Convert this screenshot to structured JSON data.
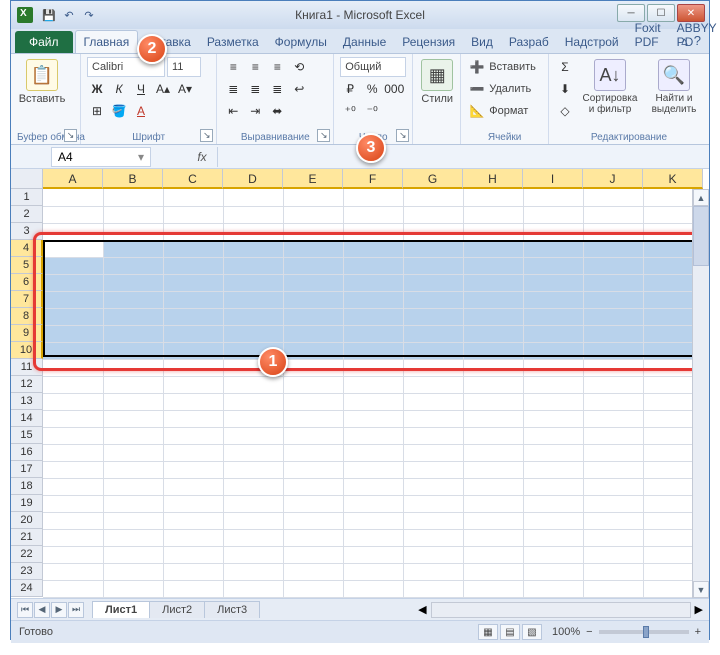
{
  "title": "Книга1 - Microsoft Excel",
  "qat": {
    "save": "💾",
    "undo": "↶",
    "redo": "↷"
  },
  "winbtns": {
    "min": "─",
    "max": "☐",
    "close": "✕"
  },
  "tabs": {
    "file": "Файл",
    "items": [
      "Главная",
      "Вставка",
      "Разметка",
      "Формулы",
      "Данные",
      "Рецензия",
      "Вид",
      "Разраб",
      "Надстрой",
      "Foxit PDF",
      "ABBYY PD"
    ],
    "active_index": 0
  },
  "help": {
    "up": "▵",
    "help": "?"
  },
  "ribbon": {
    "clipboard": {
      "paste": "Вставить",
      "label": "Буфер обмена",
      "icon": "📋"
    },
    "font": {
      "name": "Calibri",
      "size": "11",
      "label": "Шрифт",
      "bold": "Ж",
      "italic": "К",
      "underline": "Ч",
      "border": "⊞",
      "fill": "🪣",
      "color": "A"
    },
    "align": {
      "label": "Выравнивание",
      "tl": "≡",
      "tc": "≡",
      "tr": "≡",
      "wrap": "↩",
      "ml": "≣",
      "mc": "≣",
      "mr": "≣",
      "merge": "⬌",
      "il": "⇤",
      "ir": "⇥",
      "orient": "⟲"
    },
    "number": {
      "label": "Число",
      "format": "Общий",
      "cur": "%",
      "pct": "%",
      "comma": "000",
      "inc": "⁺⁰",
      "dec": "⁻⁰"
    },
    "styles": {
      "label": "Стили",
      "btn": "Стили",
      "icon": "▦"
    },
    "cells": {
      "label": "Ячейки",
      "insert": "Вставить",
      "delete": "Удалить",
      "format": "Формат",
      "ins_icon": "➕",
      "del_icon": "➖",
      "fmt_icon": "📐"
    },
    "editing": {
      "label": "Редактирование",
      "sum": "Σ",
      "fill": "⬇",
      "clear": "◇",
      "sort": "Сортировка и фильтр",
      "find": "Найти и выделить",
      "sort_icon": "A↓",
      "find_icon": "🔍"
    }
  },
  "fx": {
    "cell": "A4",
    "fx": "fx"
  },
  "columns": [
    "A",
    "B",
    "C",
    "D",
    "E",
    "F",
    "G",
    "H",
    "I",
    "J",
    "K"
  ],
  "rows_total": 24,
  "selection": {
    "row_start": 4,
    "row_end": 10,
    "active": "A4"
  },
  "sheets": {
    "nav": [
      "⏮",
      "◀",
      "▶",
      "⏭"
    ],
    "items": [
      "Лист1",
      "Лист2",
      "Лист3"
    ],
    "active": 0,
    "add": "+"
  },
  "status": {
    "ready": "Готово",
    "zoom": "100%",
    "minus": "−",
    "plus": "+"
  },
  "badges": {
    "1": "1",
    "2": "2",
    "3": "3"
  }
}
